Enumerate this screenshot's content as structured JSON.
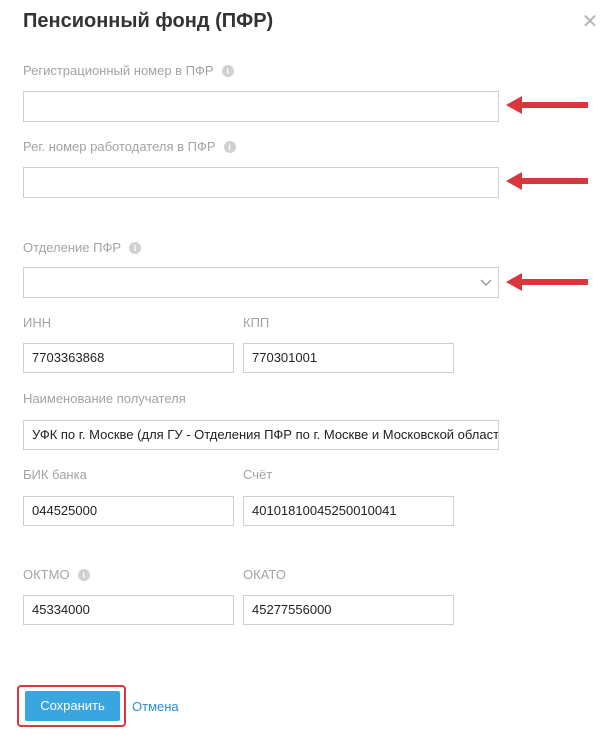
{
  "dialog": {
    "title": "Пенсионный фонд (ПФР)",
    "close_icon": "close-icon"
  },
  "fields": {
    "reg_number_pfr": {
      "label": "Регистрационный номер в ПФР",
      "value": ""
    },
    "employer_reg_number": {
      "label": "Рег. номер работодателя в ПФР",
      "value": ""
    },
    "pfr_branch": {
      "label": "Отделение ПФР",
      "value": ""
    },
    "inn": {
      "label": "ИНН",
      "value": "7703363868"
    },
    "kpp": {
      "label": "КПП",
      "value": "770301001"
    },
    "recipient_name": {
      "label": "Наименование получателя",
      "value": "УФК по г. Москве (для ГУ - Отделения ПФР по г. Москве и Московской област"
    },
    "bik": {
      "label": "БИК банка",
      "value": "044525000"
    },
    "account": {
      "label": "Счёт",
      "value": "40101810045250010041"
    },
    "oktmo": {
      "label": "ОКТМО",
      "value": "45334000"
    },
    "okato": {
      "label": "ОКАТО",
      "value": "45277556000"
    }
  },
  "actions": {
    "save_label": "Сохранить",
    "cancel_label": "Отмена"
  },
  "colors": {
    "accent": "#3aa6e0",
    "annotation_red": "#d9363e",
    "link": "#2e8ad6"
  }
}
